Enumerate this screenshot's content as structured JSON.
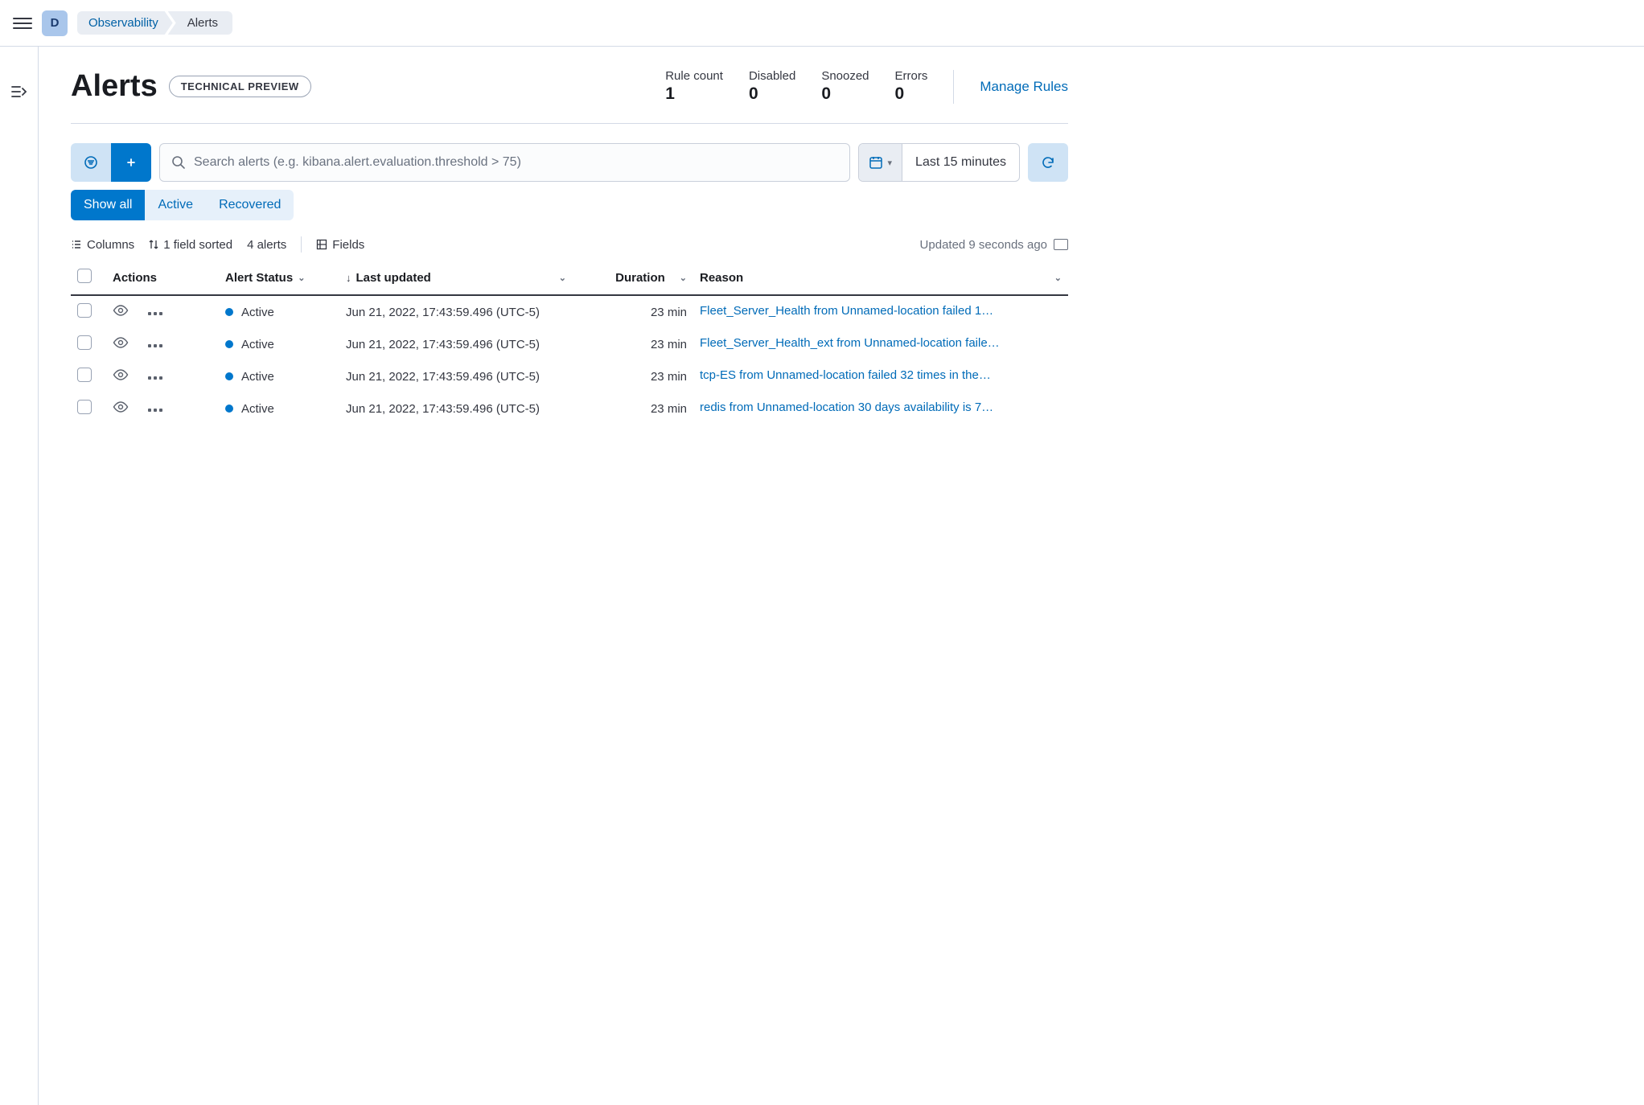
{
  "topbar": {
    "space_letter": "D",
    "breadcrumbs": [
      "Observability",
      "Alerts"
    ]
  },
  "header": {
    "title": "Alerts",
    "badge": "TECHNICAL PREVIEW",
    "stats": [
      {
        "label": "Rule count",
        "value": "1"
      },
      {
        "label": "Disabled",
        "value": "0"
      },
      {
        "label": "Snoozed",
        "value": "0"
      },
      {
        "label": "Errors",
        "value": "0"
      }
    ],
    "manage_rules": "Manage Rules"
  },
  "search": {
    "placeholder": "Search alerts (e.g. kibana.alert.evaluation.threshold > 75)",
    "date_range": "Last 15 minutes"
  },
  "filters": {
    "tabs": [
      "Show all",
      "Active",
      "Recovered"
    ],
    "active_index": 0
  },
  "toolbar": {
    "columns": "Columns",
    "sorted": "1 field sorted",
    "count": "4 alerts",
    "fields": "Fields",
    "updated": "Updated 9 seconds ago"
  },
  "table": {
    "columns": {
      "actions": "Actions",
      "status": "Alert Status",
      "last_updated": "Last updated",
      "duration": "Duration",
      "reason": "Reason"
    },
    "rows": [
      {
        "status": "Active",
        "last_updated": "Jun 21, 2022, 17:43:59.496 (UTC-5)",
        "duration": "23 min",
        "reason": "Fleet_Server_Health from Unnamed-location failed 1…"
      },
      {
        "status": "Active",
        "last_updated": "Jun 21, 2022, 17:43:59.496 (UTC-5)",
        "duration": "23 min",
        "reason": "Fleet_Server_Health_ext from Unnamed-location faile…"
      },
      {
        "status": "Active",
        "last_updated": "Jun 21, 2022, 17:43:59.496 (UTC-5)",
        "duration": "23 min",
        "reason": "tcp-ES from Unnamed-location failed 32 times in the…"
      },
      {
        "status": "Active",
        "last_updated": "Jun 21, 2022, 17:43:59.496 (UTC-5)",
        "duration": "23 min",
        "reason": "redis from Unnamed-location 30 days availability is 7…"
      }
    ]
  }
}
